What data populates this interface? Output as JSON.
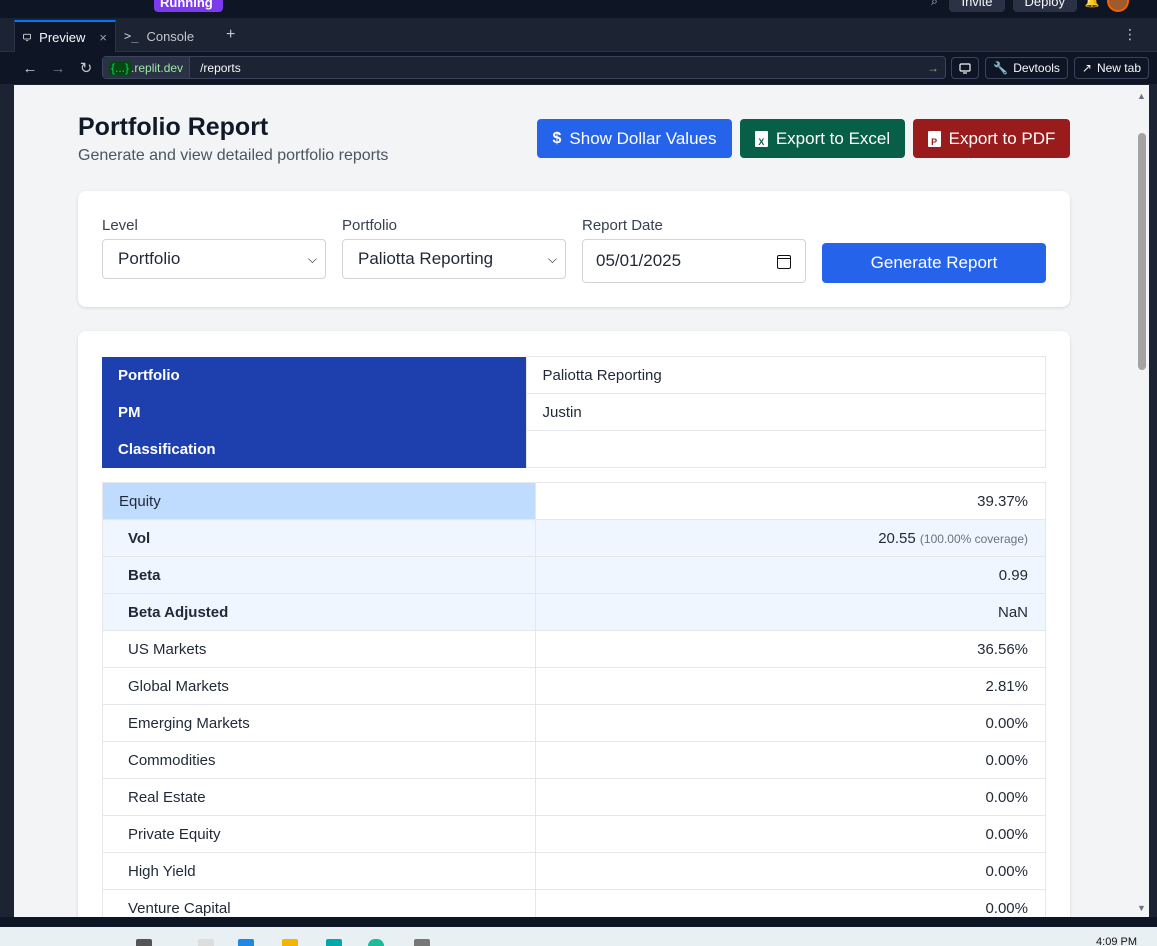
{
  "topbar": {
    "run_label": "Running",
    "invite_label": "Invite",
    "deploy_label": "Deploy"
  },
  "tabs": {
    "preview_label": "Preview",
    "console_label": "Console",
    "add_label": "+",
    "more_label": "⋮"
  },
  "urlbar": {
    "domain_prefix": "{...}",
    "domain": ".replit.dev",
    "path": "/reports",
    "devtools_label": "Devtools",
    "newtab_label": "New tab"
  },
  "header": {
    "title": "Portfolio Report",
    "subtitle": "Generate and view detailed portfolio reports",
    "show_dollar_label": "Show Dollar Values",
    "export_excel_label": "Export to Excel",
    "export_pdf_label": "Export to PDF"
  },
  "filters": {
    "level_label": "Level",
    "level_value": "Portfolio",
    "portfolio_label": "Portfolio",
    "portfolio_value": "Paliotta Reporting",
    "date_label": "Report Date",
    "date_value": "05/01/2025",
    "generate_label": "Generate Report"
  },
  "info": {
    "rows": [
      {
        "key": "Portfolio",
        "value": "Paliotta Reporting"
      },
      {
        "key": "PM",
        "value": "Justin"
      },
      {
        "key": "Classification",
        "value": ""
      }
    ]
  },
  "report": {
    "equity": {
      "name": "Equity",
      "value": "39.37%"
    },
    "vol": {
      "name": "Vol",
      "value": "20.55",
      "note": "(100.00% coverage)"
    },
    "beta": {
      "name": "Beta",
      "value": "0.99"
    },
    "beta_adj": {
      "name": "Beta Adjusted",
      "value": "NaN"
    },
    "rows": [
      {
        "name": "US Markets",
        "value": "36.56%"
      },
      {
        "name": "Global Markets",
        "value": "2.81%"
      },
      {
        "name": "Emerging Markets",
        "value": "0.00%"
      },
      {
        "name": "Commodities",
        "value": "0.00%"
      },
      {
        "name": "Real Estate",
        "value": "0.00%"
      },
      {
        "name": "Private Equity",
        "value": "0.00%"
      },
      {
        "name": "High Yield",
        "value": "0.00%"
      },
      {
        "name": "Venture Capital",
        "value": "0.00%"
      }
    ]
  },
  "taskbar": {
    "time": "4:09 PM"
  }
}
